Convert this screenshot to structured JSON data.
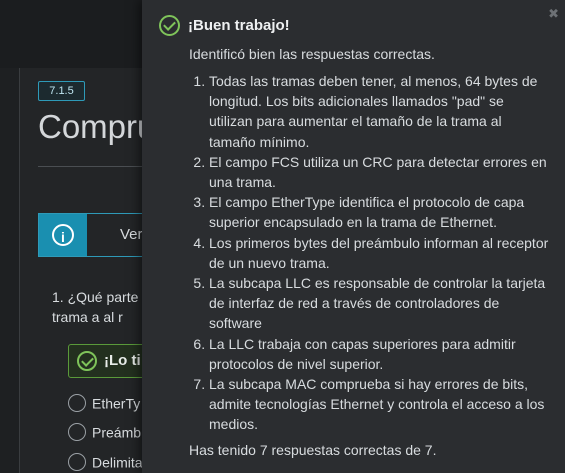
{
  "background": {
    "version_badge": "7.1.5",
    "page_title": "Compru",
    "info_bar_label": "Ver",
    "question_text": "1. ¿Qué parte trama a al r",
    "feedback_chip_label": "¡Lo ti",
    "options": [
      "EtherTy",
      "Preámb",
      "Delimita"
    ]
  },
  "popover": {
    "close_symbol": "✖",
    "title": "¡Buen trabajo!",
    "subtitle": "Identificó bien las respuestas correctas.",
    "items": [
      "Todas las tramas deben tener, al menos, 64 bytes de longitud. Los bits adicionales llamados \"pad\" se utilizan para aumentar el tamaño de la trama al tamaño mínimo.",
      "El campo FCS utiliza un CRC para detectar errores en una trama.",
      "El campo EtherType identifica el protocolo de capa superior encapsulado en la trama de Ethernet.",
      "Los primeros bytes del preámbulo informan al receptor de un nuevo trama.",
      "La subcapa LLC es responsable de controlar la tarjeta de interfaz de red a través de controladores de software",
      "La LLC trabaja con capas superiores para admitir protocolos de nivel superior.",
      "La subcapa MAC comprueba si hay errores de bits, admite tecnologías Ethernet y controla el acceso a los medios."
    ],
    "footer": "Has tenido 7 respuestas correctas de 7."
  },
  "colors": {
    "accent": "#1a8fb0",
    "success": "#7fc45a",
    "popover_bg": "#2b2d30",
    "page_bg": "#1e2022"
  }
}
